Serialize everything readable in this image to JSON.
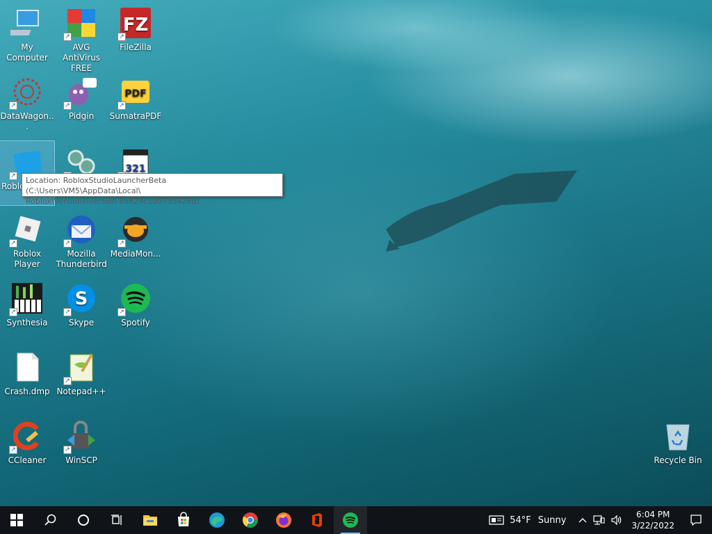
{
  "desktop": {
    "icons": [
      {
        "label": "My Computer"
      },
      {
        "label": "AVG AntiVirus FREE"
      },
      {
        "label": "FileZilla"
      },
      {
        "label": "DataWagon..."
      },
      {
        "label": "Pidgin"
      },
      {
        "label": "SumatraPDF"
      },
      {
        "label": "Roblo"
      },
      {
        "label": ""
      },
      {
        "label": ""
      },
      {
        "label": "Roblox Player"
      },
      {
        "label": "Mozilla Thunderbird"
      },
      {
        "label": "MediaMon..."
      },
      {
        "label": "Synthesia"
      },
      {
        "label": "Skype"
      },
      {
        "label": "Spotify"
      },
      {
        "label": "Crash.dmp"
      },
      {
        "label": "Notepad++"
      },
      {
        "label": "CCleaner"
      },
      {
        "label": "WinSCP"
      },
      {
        "label": "Recycle Bin"
      }
    ],
    "tooltip": {
      "line1": "Location: RobloxStudioLauncherBeta (C:\\Users\\VM5\\AppData\\Local\\",
      "line2": "Roblox\\Versions\\version-8a829c1d073d426d)"
    }
  },
  "taskbar": {
    "weather_temp": "54°F",
    "weather_text": "Sunny",
    "time": "6:04 PM",
    "date": "3/22/2022",
    "accent": "#7cc4f0"
  }
}
